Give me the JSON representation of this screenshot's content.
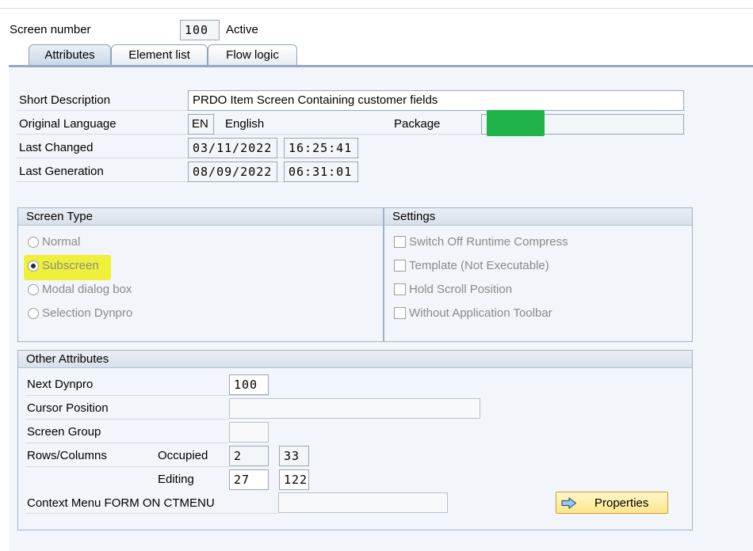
{
  "header": {
    "screen_number_label": "Screen number",
    "screen_number": "100",
    "status": "Active"
  },
  "tabs": [
    {
      "label": "Attributes",
      "active": true
    },
    {
      "label": "Element list",
      "active": false
    },
    {
      "label": "Flow logic",
      "active": false
    }
  ],
  "general": {
    "short_description_label": "Short Description",
    "short_description": "PRDO Item Screen Containing customer fields",
    "original_language_label": "Original Language",
    "language_code": "EN",
    "language_name": "English",
    "package_label": "Package",
    "last_changed_label": "Last Changed",
    "last_changed_date": "03/11/2022",
    "last_changed_time": "16:25:41",
    "last_generation_label": "Last Generation",
    "last_generation_date": "08/09/2022",
    "last_generation_time": "06:31:01"
  },
  "screen_type": {
    "title": "Screen Type",
    "options": [
      {
        "label": "Normal",
        "selected": false
      },
      {
        "label": "Subscreen",
        "selected": true
      },
      {
        "label": "Modal dialog box",
        "selected": false
      },
      {
        "label": "Selection Dynpro",
        "selected": false
      }
    ]
  },
  "settings": {
    "title": "Settings",
    "options": [
      {
        "label": "Switch Off Runtime Compress",
        "checked": false
      },
      {
        "label": "Template (Not Executable)",
        "checked": false
      },
      {
        "label": "Hold Scroll Position",
        "checked": false
      },
      {
        "label": "Without Application Toolbar",
        "checked": false
      }
    ]
  },
  "other_attributes": {
    "title": "Other Attributes",
    "next_dynpro_label": "Next Dynpro",
    "next_dynpro": "100",
    "cursor_position_label": "Cursor Position",
    "cursor_position": "",
    "screen_group_label": "Screen Group",
    "screen_group": "",
    "rows_columns_label": "Rows/Columns",
    "occupied_label": "Occupied",
    "occupied_rows": "2",
    "occupied_cols": "33",
    "editing_label": "Editing",
    "editing_rows": "27",
    "editing_cols": "122",
    "context_menu_label": "Context Menu FORM ON CTMENU",
    "context_menu_value": "",
    "properties_button": "Properties"
  },
  "colors": {
    "highlight": "#eef03a",
    "package_mask": "#1fb34a",
    "button_bg": "#fde68c",
    "tab_border": "#93abc6"
  },
  "icons": {
    "properties_button_icon": "arrow-right-icon"
  }
}
